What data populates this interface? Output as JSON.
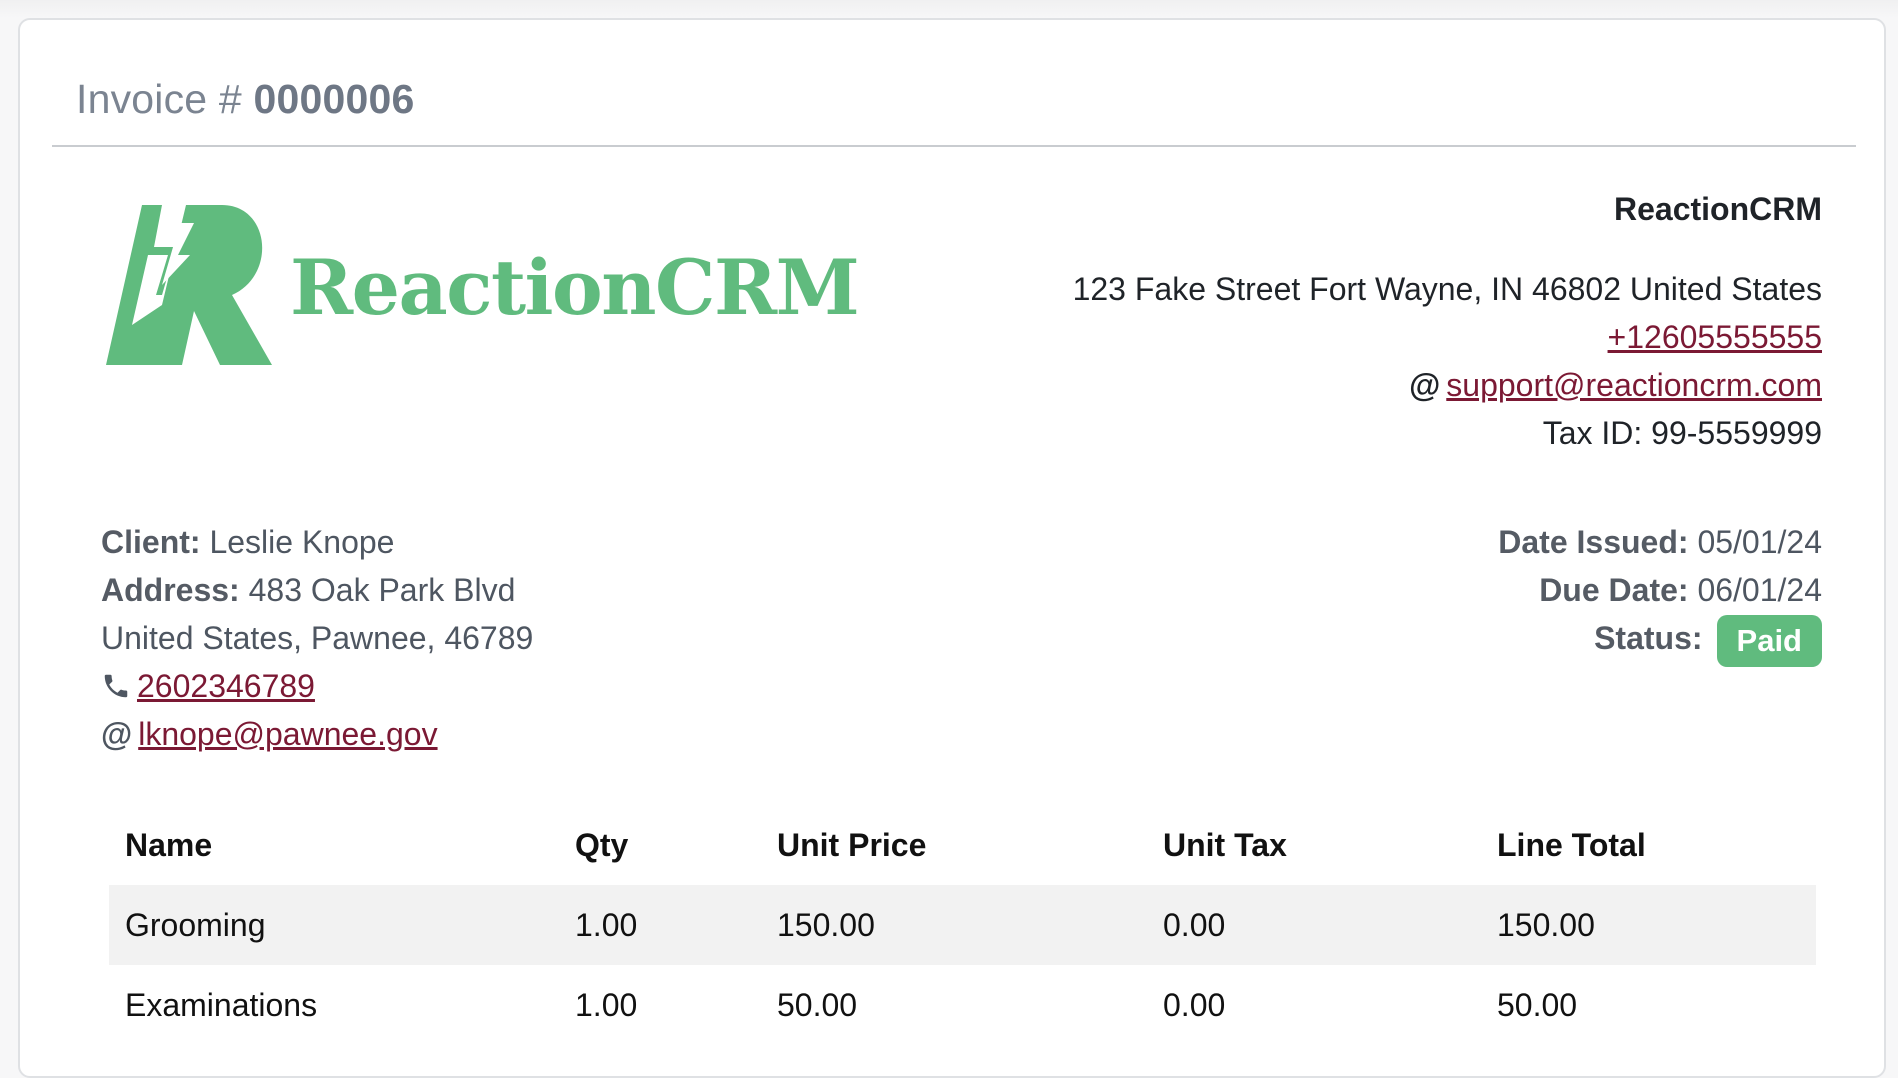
{
  "invoice": {
    "label": "Invoice #",
    "number": "0000006"
  },
  "logo": {
    "text": "ReactionCRM",
    "color": "#60bb7e"
  },
  "company": {
    "name": "ReactionCRM",
    "address": "123 Fake Street Fort Wayne, IN 46802 United States",
    "phone": "+12605555555",
    "email_symbol": "@",
    "email": "support@reactioncrm.com",
    "tax_id": "Tax ID: 99-5559999"
  },
  "client": {
    "client_label": "Client:",
    "client_name": "Leslie Knope",
    "address_label": "Address:",
    "address_line1": "483 Oak Park Blvd",
    "address_line2": "United States, Pawnee, 46789",
    "phone": "2602346789",
    "email_symbol": "@",
    "email": "lknope@pawnee.gov"
  },
  "meta": {
    "issued_label": "Date Issued:",
    "issued_value": "05/01/24",
    "due_label": "Due Date:",
    "due_value": "06/01/24",
    "status_label": "Status:",
    "status_value": "Paid",
    "status_color": "#60bb7e"
  },
  "table": {
    "headers": [
      "Name",
      "Qty",
      "Unit Price",
      "Unit Tax",
      "Line Total"
    ],
    "rows": [
      [
        "Grooming",
        "1.00",
        "150.00",
        "0.00",
        "150.00"
      ],
      [
        "Examinations",
        "1.00",
        "50.00",
        "0.00",
        "50.00"
      ]
    ]
  },
  "colors": {
    "link": "#7b1934",
    "accent": "#60bb7e"
  }
}
